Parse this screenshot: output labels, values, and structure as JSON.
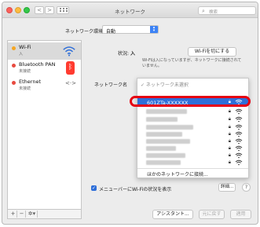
{
  "window": {
    "title": "ネットワーク",
    "search_placeholder": "検索",
    "nav_back": "<",
    "nav_forward": ">",
    "search_icon": "search-icon"
  },
  "location": {
    "label": "ネットワーク環境:",
    "value": "自動"
  },
  "sidebar": {
    "items": [
      {
        "name": "Wi-Fi",
        "status": "入",
        "status_color": "#f5a623",
        "icon": "wifi-icon"
      },
      {
        "name": "Bluetooth PAN",
        "status": "未接続",
        "status_color": "#e84a3f",
        "icon": "bluetooth-icon"
      },
      {
        "name": "Ethernet",
        "status": "未接続",
        "status_color": "#e84a3f",
        "icon": "ethernet-icon"
      }
    ],
    "add": "+",
    "remove": "−",
    "gear": "✲▾"
  },
  "status": {
    "label": "状況:",
    "value": "入",
    "button": "Wi-Fiを切にする",
    "description": "Wi-Fiは入になっていますが、ネットワークに接続されていません。"
  },
  "network_name": {
    "label": "ネットワーク名",
    "search_placeholder": "✓ ネットワーク未選択",
    "selected": "601ZTa-XXXXXX",
    "other": "ほかのネットワークに接続..."
  },
  "menubar": {
    "checked": true,
    "label": "メニューバーにWi-Fiの状況を表示",
    "detail_button": "詳細...",
    "help": "?"
  },
  "footer": {
    "assist": "アシスタント...",
    "revert": "元に戻す",
    "apply": "適用"
  },
  "colors": {
    "accent": "#2f6fd9",
    "highlight": "#e60012"
  }
}
